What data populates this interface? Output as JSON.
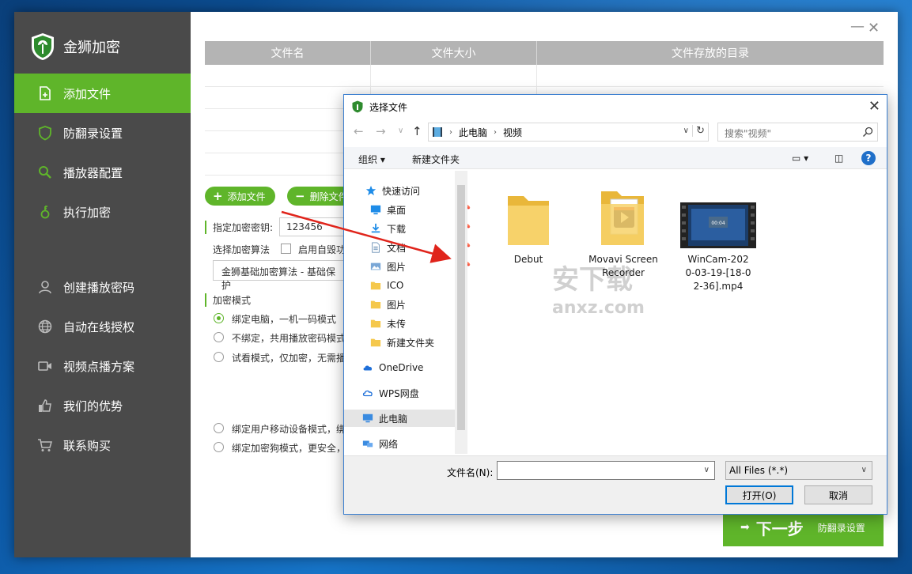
{
  "app": {
    "name": "金狮加密",
    "colors": {
      "accent": "#5fb52a",
      "sidebar": "#4a4a4a",
      "table_header": "#b4b4b4"
    }
  },
  "sidebar": {
    "items": [
      {
        "label": "添加文件",
        "icon": "add-file-icon",
        "active": true
      },
      {
        "label": "防翻录设置",
        "icon": "shield-icon"
      },
      {
        "label": "播放器配置",
        "icon": "search-icon"
      },
      {
        "label": "执行加密",
        "icon": "lock-icon"
      },
      {
        "label": "创建播放密码",
        "icon": "user-icon"
      },
      {
        "label": "自动在线授权",
        "icon": "globe-icon"
      },
      {
        "label": "视频点播方案",
        "icon": "video-camera-icon"
      },
      {
        "label": "我们的优势",
        "icon": "thumbs-up-icon"
      },
      {
        "label": "联系购买",
        "icon": "cart-icon"
      }
    ]
  },
  "window": {
    "minimize": "—",
    "close": "✕"
  },
  "file_table": {
    "columns": [
      "文件名",
      "文件大小",
      "文件存放的目录"
    ],
    "rows": []
  },
  "actions": {
    "add_file": "添加文件",
    "delete_file": "删除文件"
  },
  "settings": {
    "key_label": "指定加密密钥:",
    "key_value": "123456",
    "algo_label": "选择加密算法",
    "auto_destroy": "启用自毁功",
    "algo_value": "金狮基础加密算法 - 基础保护",
    "mode_label": "加密模式",
    "modes": [
      {
        "label": "绑定电脑，一机一码模式",
        "selected": true
      },
      {
        "label": "不绑定，共用播放密码模式",
        "selected": false
      },
      {
        "label": "试看模式，仅加密，无需播",
        "selected": false
      },
      {
        "label": "绑定用户移动设备模式，绑",
        "selected": false
      },
      {
        "label": "绑定加密狗模式，更安全，",
        "selected": false
      }
    ]
  },
  "next_button": {
    "big": "下一步",
    "small": "防翻录设置"
  },
  "dialog": {
    "title": "选择文件",
    "path": [
      "此电脑",
      "视频"
    ],
    "search_placeholder": "搜索\"视频\"",
    "toolbar": {
      "organize": "组织 ▾",
      "new_folder": "新建文件夹"
    },
    "tree": [
      {
        "label": "快速访问",
        "icon": "star-icon",
        "pinned": false
      },
      {
        "label": "桌面",
        "icon": "desktop-icon",
        "pinned": true
      },
      {
        "label": "下载",
        "icon": "download-icon",
        "pinned": true
      },
      {
        "label": "文档",
        "icon": "document-icon",
        "pinned": true
      },
      {
        "label": "图片",
        "icon": "picture-icon",
        "pinned": true
      },
      {
        "label": "ICO",
        "icon": "folder-icon",
        "pinned": false
      },
      {
        "label": "图片",
        "icon": "folder-icon",
        "pinned": false
      },
      {
        "label": "未传",
        "icon": "folder-icon",
        "pinned": false
      },
      {
        "label": "新建文件夹",
        "icon": "folder-icon",
        "pinned": false
      },
      {
        "label": "OneDrive",
        "icon": "cloud-icon",
        "pinned": false
      },
      {
        "label": "WPS网盘",
        "icon": "cloud-icon",
        "pinned": false
      },
      {
        "label": "此电脑",
        "icon": "computer-icon",
        "pinned": false,
        "selected": true
      },
      {
        "label": "网络",
        "icon": "network-icon",
        "pinned": false
      }
    ],
    "files": [
      {
        "label": "Debut",
        "kind": "folder"
      },
      {
        "label": "Movavi Screen Recorder",
        "kind": "folder-media"
      },
      {
        "label": "WinCam-2020-03-19-[18-02-36].mp4",
        "kind": "video",
        "thumb_time": "00:04"
      }
    ],
    "filename_label": "文件名(N):",
    "filename_value": "",
    "filetype": "All Files (*.*)",
    "open": "打开(O)",
    "cancel": "取消"
  },
  "watermark": {
    "main": "安下载",
    "sub": "anxz.com"
  }
}
